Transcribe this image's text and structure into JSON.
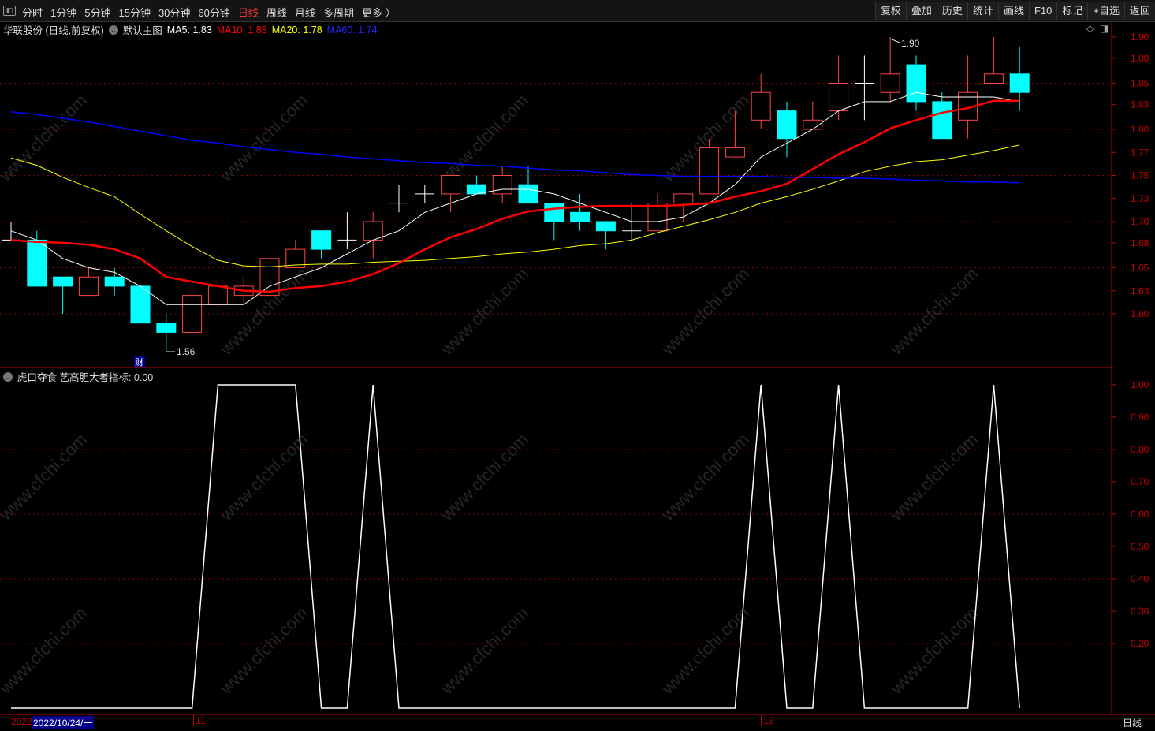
{
  "toolbar": {
    "periods": [
      "分时",
      "1分钟",
      "5分钟",
      "15分钟",
      "30分钟",
      "60分钟",
      "日线",
      "周线",
      "月线",
      "多周期",
      "更多 〉"
    ],
    "active_period": "日线",
    "buttons": [
      "复权",
      "叠加",
      "历史",
      "统计",
      "画线",
      "F10",
      "标记",
      "+自选",
      "返回"
    ]
  },
  "legend": {
    "title": "华联股份 (日线,前复权)",
    "main_chart": "默认主图",
    "ma5": "MA5: 1.83",
    "ma10": "MA10: 1.83",
    "ma20": "MA20: 1.78",
    "ma60": "MA60: 1.74"
  },
  "indicator": {
    "label": "虎口夺食 艺高胆大者指标: 0.00"
  },
  "colors": {
    "up": "#ff4444",
    "down": "#00ffff",
    "ma5": "#ffffff",
    "ma10": "#ff0000",
    "ma20": "#ffff00",
    "ma60": "#0000ff",
    "grid": "#8b0000",
    "axis": "#cc0000"
  },
  "annotations": {
    "high": "1.90",
    "low": "1.56",
    "cai": "财"
  },
  "watermark": "www.cfchi.com",
  "dates": {
    "year": "2022",
    "cursor": "2022/10/24/一",
    "m11": "11",
    "m12": "12",
    "period": "日线"
  },
  "chart_data": [
    {
      "type": "candlestick",
      "title": "华联股份 (日线,前复权)",
      "ylim": [
        1.54,
        1.92
      ],
      "y_ticks": [
        "1.90",
        "1.88",
        "1.85",
        "1.83",
        "1.80",
        "1.77",
        "1.75",
        "1.73",
        "1.70",
        "1.68",
        "1.65",
        "1.63",
        "1.60"
      ],
      "y_tick_values": [
        1.9,
        1.877,
        1.85,
        1.827,
        1.8,
        1.775,
        1.75,
        1.725,
        1.7,
        1.677,
        1.65,
        1.625,
        1.6
      ],
      "ohlc": [
        [
          1.68,
          1.7,
          1.68,
          1.68
        ],
        [
          1.68,
          1.69,
          1.63,
          1.63
        ],
        [
          1.64,
          1.64,
          1.6,
          1.63
        ],
        [
          1.62,
          1.65,
          1.62,
          1.64
        ],
        [
          1.64,
          1.65,
          1.62,
          1.63
        ],
        [
          1.63,
          1.63,
          1.59,
          1.59
        ],
        [
          1.59,
          1.6,
          1.56,
          1.58
        ],
        [
          1.58,
          1.62,
          1.58,
          1.62
        ],
        [
          1.61,
          1.64,
          1.6,
          1.63
        ],
        [
          1.62,
          1.64,
          1.61,
          1.63
        ],
        [
          1.62,
          1.66,
          1.62,
          1.66
        ],
        [
          1.65,
          1.68,
          1.65,
          1.67
        ],
        [
          1.69,
          1.69,
          1.66,
          1.67
        ],
        [
          1.68,
          1.71,
          1.67,
          1.68
        ],
        [
          1.68,
          1.71,
          1.66,
          1.7
        ],
        [
          1.72,
          1.74,
          1.71,
          1.72
        ],
        [
          1.73,
          1.74,
          1.72,
          1.73
        ],
        [
          1.73,
          1.75,
          1.71,
          1.75
        ],
        [
          1.74,
          1.75,
          1.73,
          1.73
        ],
        [
          1.73,
          1.76,
          1.72,
          1.75
        ],
        [
          1.74,
          1.76,
          1.72,
          1.72
        ],
        [
          1.72,
          1.72,
          1.68,
          1.7
        ],
        [
          1.71,
          1.73,
          1.69,
          1.7
        ],
        [
          1.7,
          1.7,
          1.67,
          1.69
        ],
        [
          1.69,
          1.72,
          1.68,
          1.69
        ],
        [
          1.69,
          1.73,
          1.69,
          1.72
        ],
        [
          1.72,
          1.73,
          1.7,
          1.73
        ],
        [
          1.73,
          1.79,
          1.73,
          1.78
        ],
        [
          1.77,
          1.82,
          1.77,
          1.78
        ],
        [
          1.81,
          1.86,
          1.8,
          1.84
        ],
        [
          1.82,
          1.83,
          1.77,
          1.79
        ],
        [
          1.8,
          1.83,
          1.8,
          1.81
        ],
        [
          1.82,
          1.88,
          1.81,
          1.85
        ],
        [
          1.85,
          1.88,
          1.81,
          1.85
        ],
        [
          1.84,
          1.9,
          1.83,
          1.86
        ],
        [
          1.87,
          1.88,
          1.82,
          1.83
        ],
        [
          1.83,
          1.84,
          1.79,
          1.79
        ],
        [
          1.81,
          1.88,
          1.79,
          1.84
        ],
        [
          1.85,
          1.9,
          1.85,
          1.86
        ],
        [
          1.86,
          1.89,
          1.82,
          1.84
        ]
      ],
      "ma5": [
        1.69,
        1.68,
        1.66,
        1.65,
        1.645,
        1.63,
        1.61,
        1.61,
        1.61,
        1.61,
        1.63,
        1.64,
        1.65,
        1.665,
        1.68,
        1.69,
        1.71,
        1.72,
        1.73,
        1.735,
        1.735,
        1.73,
        1.72,
        1.71,
        1.7,
        1.7,
        1.705,
        1.72,
        1.74,
        1.77,
        1.785,
        1.8,
        1.82,
        1.83,
        1.83,
        1.84,
        1.835,
        1.835,
        1.835,
        1.83
      ],
      "ma10": [
        1.68,
        1.678,
        1.677,
        1.675,
        1.67,
        1.66,
        1.64,
        1.635,
        1.63,
        1.625,
        1.624,
        1.628,
        1.63,
        1.635,
        1.643,
        1.655,
        1.67,
        1.683,
        1.692,
        1.703,
        1.711,
        1.714,
        1.716,
        1.717,
        1.717,
        1.717,
        1.718,
        1.72,
        1.727,
        1.733,
        1.741,
        1.757,
        1.773,
        1.786,
        1.801,
        1.81,
        1.818,
        1.823,
        1.831,
        1.831
      ],
      "ma20": [
        1.769,
        1.761,
        1.748,
        1.737,
        1.727,
        1.708,
        1.69,
        1.673,
        1.658,
        1.652,
        1.651,
        1.653,
        1.654,
        1.654,
        1.656,
        1.657,
        1.658,
        1.66,
        1.662,
        1.665,
        1.667,
        1.67,
        1.674,
        1.676,
        1.68,
        1.688,
        1.695,
        1.702,
        1.71,
        1.72,
        1.727,
        1.735,
        1.744,
        1.754,
        1.76,
        1.765,
        1.767,
        1.772,
        1.777,
        1.783
      ],
      "ma60": [
        1.819,
        1.816,
        1.812,
        1.808,
        1.803,
        1.798,
        1.793,
        1.788,
        1.785,
        1.781,
        1.778,
        1.775,
        1.773,
        1.77,
        1.768,
        1.766,
        1.764,
        1.763,
        1.761,
        1.76,
        1.758,
        1.756,
        1.755,
        1.753,
        1.751,
        1.75,
        1.749,
        1.749,
        1.749,
        1.749,
        1.748,
        1.748,
        1.747,
        1.747,
        1.746,
        1.745,
        1.744,
        1.743,
        1.743,
        1.742
      ]
    },
    {
      "type": "line",
      "title": "虎口夺食 艺高胆大者指标",
      "ylim": [
        0,
        1
      ],
      "y_ticks": [
        "1.00",
        "0.90",
        "0.80",
        "0.70",
        "0.60",
        "0.50",
        "0.40",
        "0.30",
        "0.20"
      ],
      "y_tick_values": [
        1.0,
        0.9,
        0.8,
        0.7,
        0.6,
        0.5,
        0.4,
        0.3,
        0.2
      ],
      "values": [
        0,
        0,
        0,
        0,
        0,
        0,
        0,
        0,
        1,
        1,
        1,
        1,
        0,
        0,
        1,
        0,
        0,
        0,
        0,
        0,
        0,
        0,
        0,
        0,
        0,
        0,
        0,
        0,
        0,
        1,
        0,
        0,
        1,
        0,
        0,
        0,
        0,
        0,
        1,
        0
      ]
    }
  ]
}
